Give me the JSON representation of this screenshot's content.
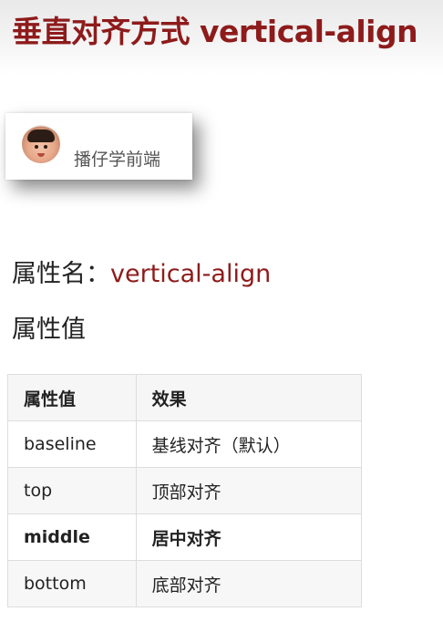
{
  "page": {
    "title": "垂直对齐方式 vertical-align"
  },
  "author_card": {
    "name": "播仔学前端"
  },
  "property": {
    "name_label": "属性名：",
    "name_value": "vertical-align",
    "values_heading": "属性值"
  },
  "table": {
    "headers": [
      "属性值",
      "效果"
    ],
    "rows": [
      {
        "value": "baseline",
        "effect": "基线对齐（默认）"
      },
      {
        "value": "top",
        "effect": "顶部对齐"
      },
      {
        "value": "middle",
        "effect": "居中对齐"
      },
      {
        "value": "bottom",
        "effect": "底部对齐"
      }
    ]
  },
  "colors": {
    "accent": "#8e1b1b",
    "text": "#222222",
    "table_border": "#dddddd",
    "table_header_bg": "#f6f6f6"
  }
}
